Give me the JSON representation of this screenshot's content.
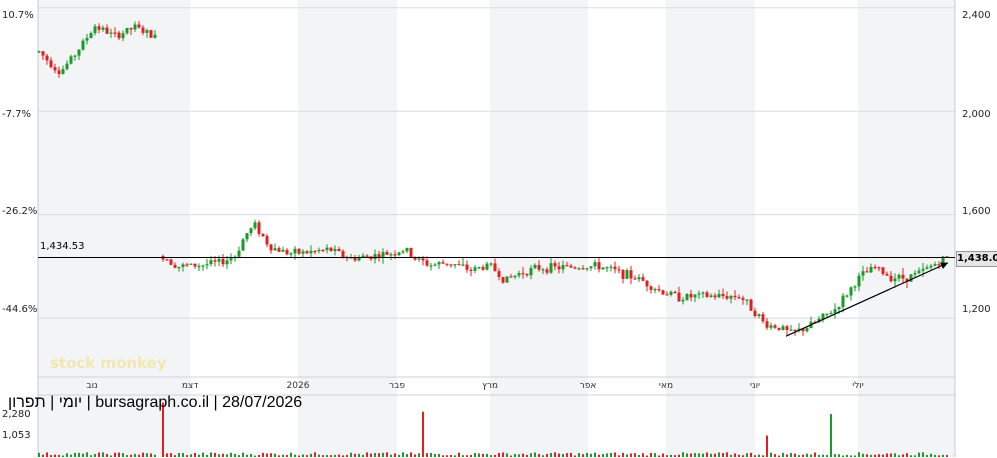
{
  "chart_data": {
    "type": "candlestick",
    "price_axis_left": [
      "10.7%",
      "-7.7%",
      "-26.2%",
      "-44.6%"
    ],
    "price_axis_right": [
      "2,400",
      "2,000",
      "1,600",
      "1,200"
    ],
    "volume_axis": [
      "2,280",
      "1,053"
    ],
    "x_labels": [
      "נוב",
      "דצמ",
      "2026",
      "פבר",
      "מרץ",
      "אפר",
      "מאי",
      "יוני",
      "יולי"
    ],
    "reference_line_label": "1,434.53",
    "last_price_label": "1,438.00",
    "caption": "יומי | תפרון | bursagraph.co.il | 28/07/2026",
    "watermark": "stock monkey",
    "ylim": [
      980,
      2430
    ],
    "reference_value": 1434.53,
    "last_value": 1438.0,
    "trendline": [
      [
        786,
        1130
      ],
      [
        948,
        1414
      ]
    ],
    "segments": [
      {
        "start_x": 39,
        "end_x": 158,
        "points": [
          [
            39,
            2230
          ],
          [
            60,
            2150
          ],
          [
            75,
            2220
          ],
          [
            95,
            2330
          ],
          [
            115,
            2290
          ],
          [
            135,
            2325
          ],
          [
            158,
            2280
          ]
        ]
      },
      {
        "start_x": 163,
        "end_x": 948,
        "points": [
          [
            163,
            1440
          ],
          [
            178,
            1400
          ],
          [
            200,
            1405
          ],
          [
            220,
            1415
          ],
          [
            235,
            1440
          ],
          [
            245,
            1520
          ],
          [
            255,
            1560
          ],
          [
            270,
            1475
          ],
          [
            290,
            1450
          ],
          [
            310,
            1455
          ],
          [
            330,
            1465
          ],
          [
            350,
            1430
          ],
          [
            370,
            1440
          ],
          [
            390,
            1450
          ],
          [
            405,
            1465
          ],
          [
            415,
            1430
          ],
          [
            430,
            1405
          ],
          [
            450,
            1415
          ],
          [
            470,
            1385
          ],
          [
            490,
            1405
          ],
          [
            505,
            1345
          ],
          [
            520,
            1375
          ],
          [
            540,
            1395
          ],
          [
            560,
            1395
          ],
          [
            580,
            1400
          ],
          [
            600,
            1400
          ],
          [
            620,
            1375
          ],
          [
            640,
            1350
          ],
          [
            660,
            1305
          ],
          [
            680,
            1280
          ],
          [
            700,
            1285
          ],
          [
            720,
            1285
          ],
          [
            740,
            1285
          ],
          [
            755,
            1225
          ],
          [
            765,
            1175
          ],
          [
            780,
            1165
          ],
          [
            790,
            1140
          ],
          [
            805,
            1160
          ],
          [
            820,
            1195
          ],
          [
            835,
            1235
          ],
          [
            850,
            1310
          ],
          [
            860,
            1360
          ],
          [
            875,
            1395
          ],
          [
            890,
            1360
          ],
          [
            905,
            1355
          ],
          [
            920,
            1375
          ],
          [
            935,
            1410
          ],
          [
            948,
            1438
          ]
        ]
      }
    ],
    "volume_spikes": [
      [
        163,
        2280
      ],
      [
        422,
        1900
      ],
      [
        768,
        900
      ],
      [
        830,
        1800
      ]
    ],
    "volume_max": 2600
  }
}
